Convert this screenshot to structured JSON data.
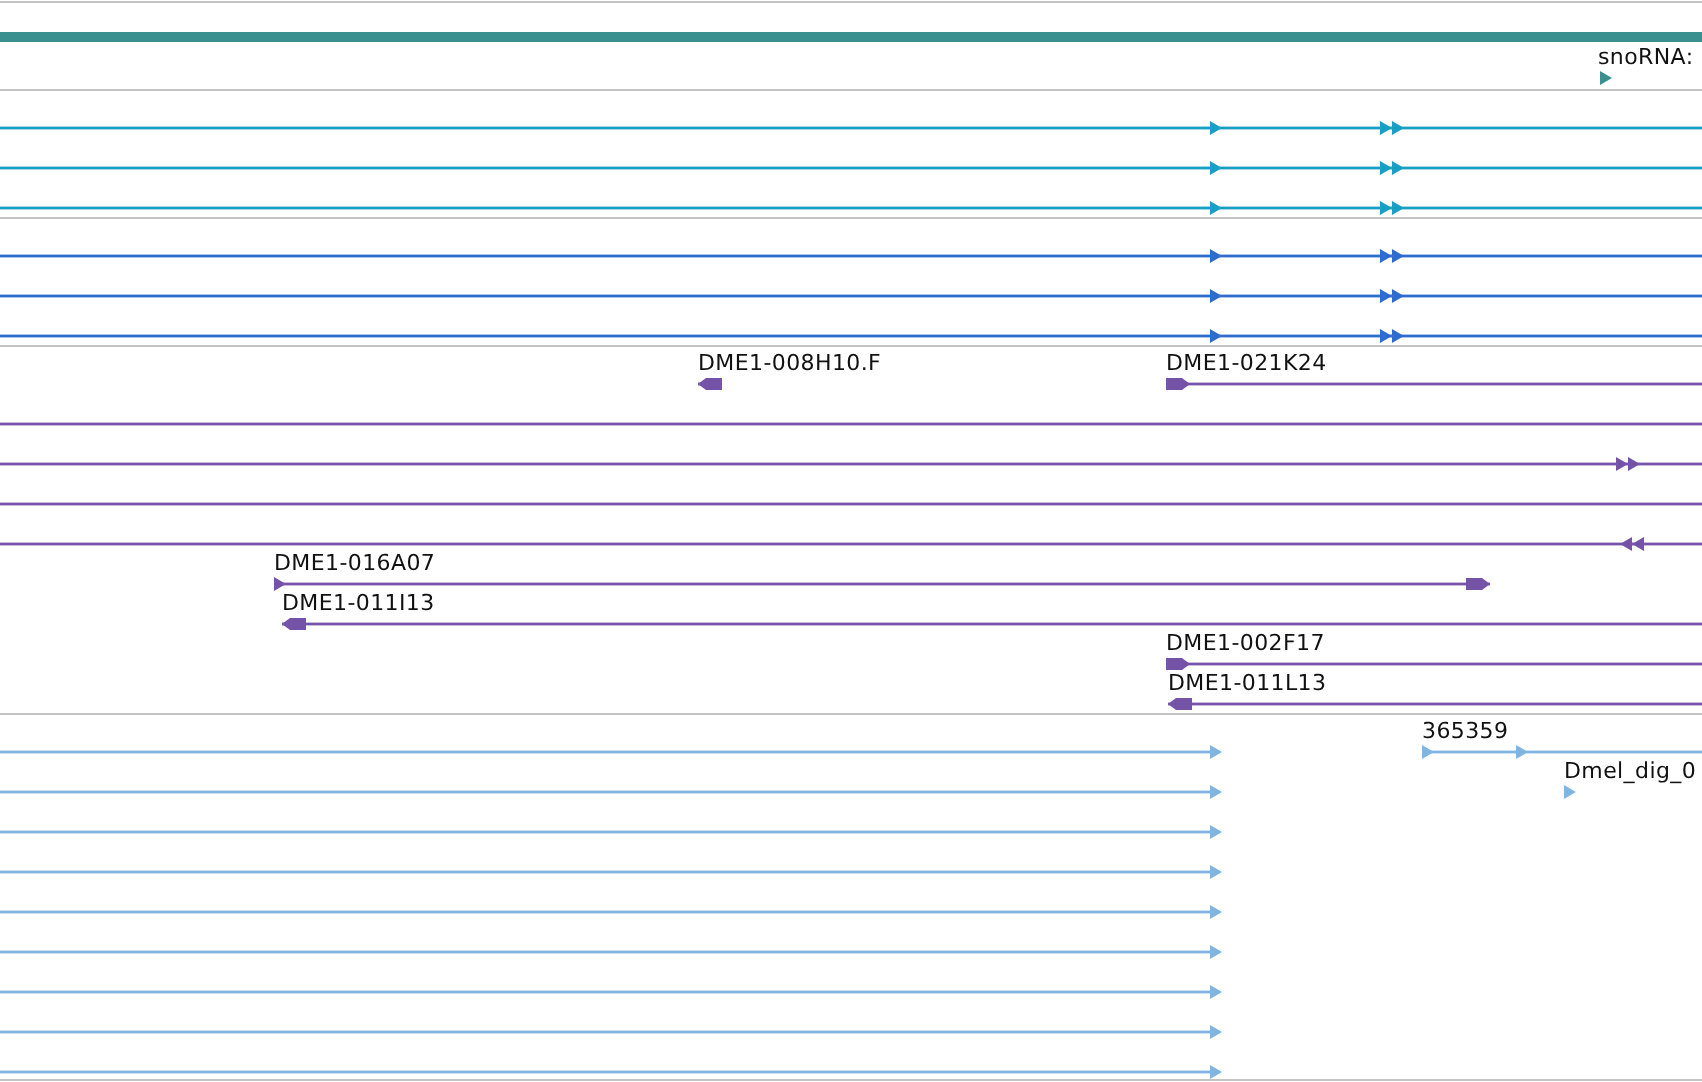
{
  "tracks": [
    {
      "color": "#3a8f8f",
      "features": [
        {
          "kind": "block"
        },
        {
          "kind": "transcript",
          "label": "snoRNA:",
          "reverse": false
        }
      ]
    },
    {
      "color": "#1a9fc4",
      "features": [
        {
          "kind": "transcript",
          "reverse": false
        },
        {
          "kind": "transcript",
          "reverse": false
        },
        {
          "kind": "transcript",
          "reverse": false
        }
      ]
    },
    {
      "color": "#2f6ccf",
      "features": [
        {
          "kind": "transcript",
          "reverse": false
        },
        {
          "kind": "transcript",
          "reverse": false
        },
        {
          "kind": "transcript",
          "reverse": false
        }
      ]
    },
    {
      "color": "#7453a8",
      "features": [
        {
          "kind": "transcript",
          "label": "DME1-008H10.F",
          "reverse": true
        },
        {
          "kind": "transcript",
          "label": "DME1-021K24",
          "reverse": false
        },
        {
          "kind": "transcript"
        },
        {
          "kind": "transcript",
          "reverse": false
        },
        {
          "kind": "transcript"
        },
        {
          "kind": "transcript",
          "reverse": true
        },
        {
          "kind": "transcript",
          "label": "DME1-016A07",
          "reverse": false
        },
        {
          "kind": "transcript",
          "label": "DME1-011I13",
          "reverse": true
        },
        {
          "kind": "transcript",
          "label": "DME1-002F17",
          "reverse": false
        },
        {
          "kind": "transcript",
          "label": "DME1-011L13",
          "reverse": true
        }
      ]
    },
    {
      "color": "#7fb5e0",
      "features": [
        {
          "kind": "transcript",
          "reverse": false
        },
        {
          "kind": "transcript",
          "reverse": false
        },
        {
          "kind": "transcript",
          "reverse": false
        },
        {
          "kind": "transcript",
          "reverse": false
        },
        {
          "kind": "transcript",
          "reverse": false
        },
        {
          "kind": "transcript",
          "reverse": false
        },
        {
          "kind": "transcript",
          "reverse": false
        },
        {
          "kind": "transcript",
          "reverse": false
        },
        {
          "kind": "transcript",
          "reverse": false
        },
        {
          "kind": "transcript",
          "label": "365359",
          "reverse": false
        },
        {
          "kind": "transcript",
          "label": "Dmel_dig_0",
          "reverse": false
        }
      ]
    }
  ]
}
